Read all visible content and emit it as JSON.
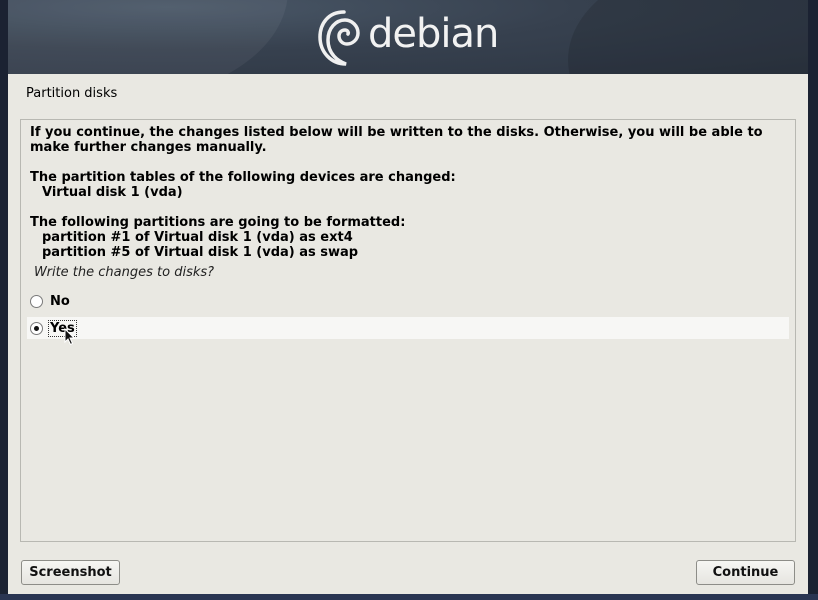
{
  "header": {
    "logo_text": "debian"
  },
  "window": {
    "title": "Partition disks"
  },
  "message": {
    "line1": "If you continue, the changes listed below will be written to the disks. Otherwise, you will be able to make further changes manually.",
    "line2": "The partition tables of the following devices are changed:",
    "device1": "Virtual disk 1 (vda)",
    "line3": "The following partitions are going to be formatted:",
    "part1": "partition #1 of Virtual disk 1 (vda) as ext4",
    "part2": "partition #5 of Virtual disk 1 (vda) as swap"
  },
  "question": "Write the changes to disks?",
  "options": [
    {
      "label": "No",
      "selected": false
    },
    {
      "label": "Yes",
      "selected": true
    }
  ],
  "buttons": {
    "screenshot": "Screenshot",
    "continue": "Continue"
  },
  "colors": {
    "header_bg": "#37414f",
    "window_bg": "#e9e8e2",
    "frame": "#1b2232"
  }
}
